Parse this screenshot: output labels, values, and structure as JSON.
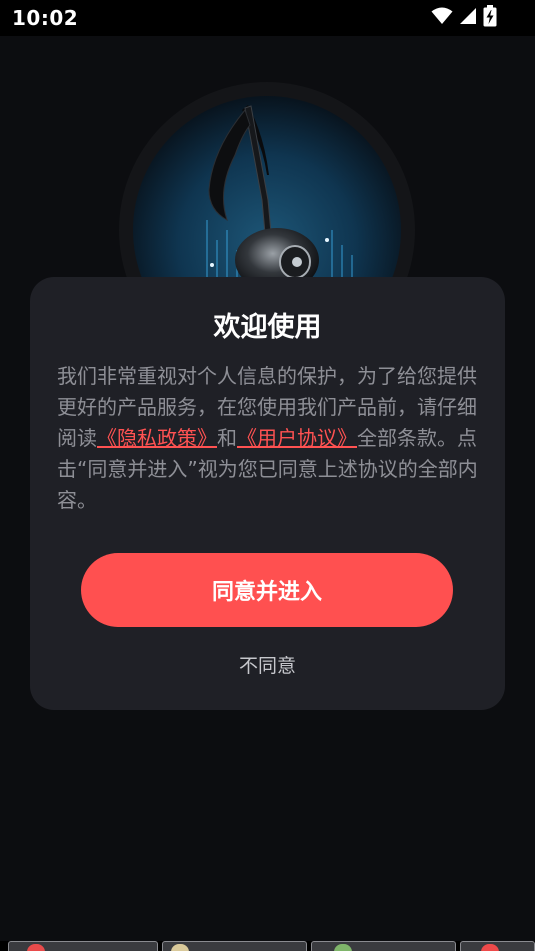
{
  "status_bar": {
    "time": "10:02"
  },
  "dialog": {
    "title": "欢迎使用",
    "body_prefix": "我们非常重视对个人信息的保护，为了给您提供更好的产品服务，在您使用我们产品前，请仔细阅读",
    "privacy_link": "《隐私政策》",
    "body_and": "和",
    "user_agreement_link": "《用户协议》",
    "body_suffix": "全部条款。点击“同意并进入”视为您已同意上述协议的全部内容。",
    "agree_label": "同意并进入",
    "disagree_label": "不同意"
  },
  "colors": {
    "accent": "#ff5050",
    "dialog_bg": "#1f2026",
    "screen_bg": "#0c0d10"
  },
  "icons": [
    "wifi-icon",
    "cell-signal-icon",
    "battery-charging-icon",
    "music-note-logo"
  ]
}
